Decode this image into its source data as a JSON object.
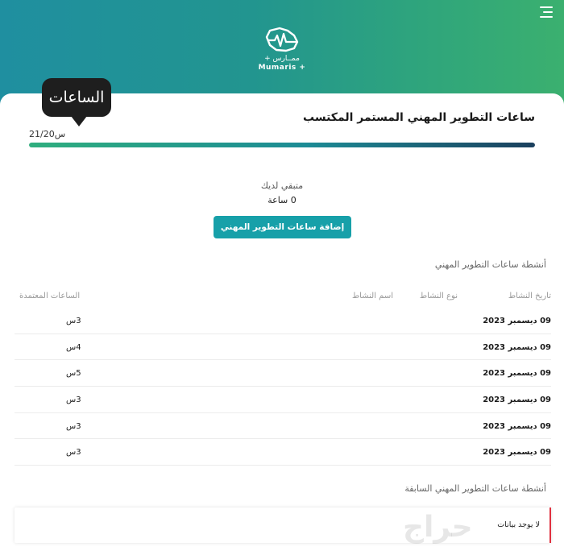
{
  "header": {
    "logo": {
      "arabic": "+ ممــارس",
      "english": "Mumaris +"
    }
  },
  "bubble": {
    "label": "الساعات"
  },
  "summary": {
    "title": "ساعات التطوير المهني المستمر المكتسب",
    "progress_text": "21/20س",
    "progress_fraction": 1.0,
    "remaining_label": "متبقي لديك",
    "remaining_value": "0 ساعة"
  },
  "actions": {
    "add_label": "إضافة ساعات التطوير المهني"
  },
  "activities": {
    "heading": "أنشطة ساعات التطوير المهني",
    "columns": {
      "date": "تاريخ النشاط",
      "type": "نوع النشاط",
      "name": "اسم النشاط",
      "hours": "الساعات المعتمدة"
    },
    "rows": [
      {
        "date": "09 ديسمبر 2023",
        "hours": "3س"
      },
      {
        "date": "09 ديسمبر 2023",
        "hours": "4س"
      },
      {
        "date": "09 ديسمبر 2023",
        "hours": "5س"
      },
      {
        "date": "09 ديسمبر 2023",
        "hours": "3س"
      },
      {
        "date": "09 ديسمبر 2023",
        "hours": "3س"
      },
      {
        "date": "09 ديسمبر 2023",
        "hours": "3س"
      }
    ]
  },
  "previous": {
    "heading": "أنشطة ساعات التطوير المهني السابقة",
    "empty_text": "لا يوجد بيانات"
  },
  "watermark": "حراج",
  "colors": {
    "header_start": "#1f8fa0",
    "header_end": "#3bb06f",
    "button": "#17a0a9",
    "accent_red": "#e0313f"
  }
}
